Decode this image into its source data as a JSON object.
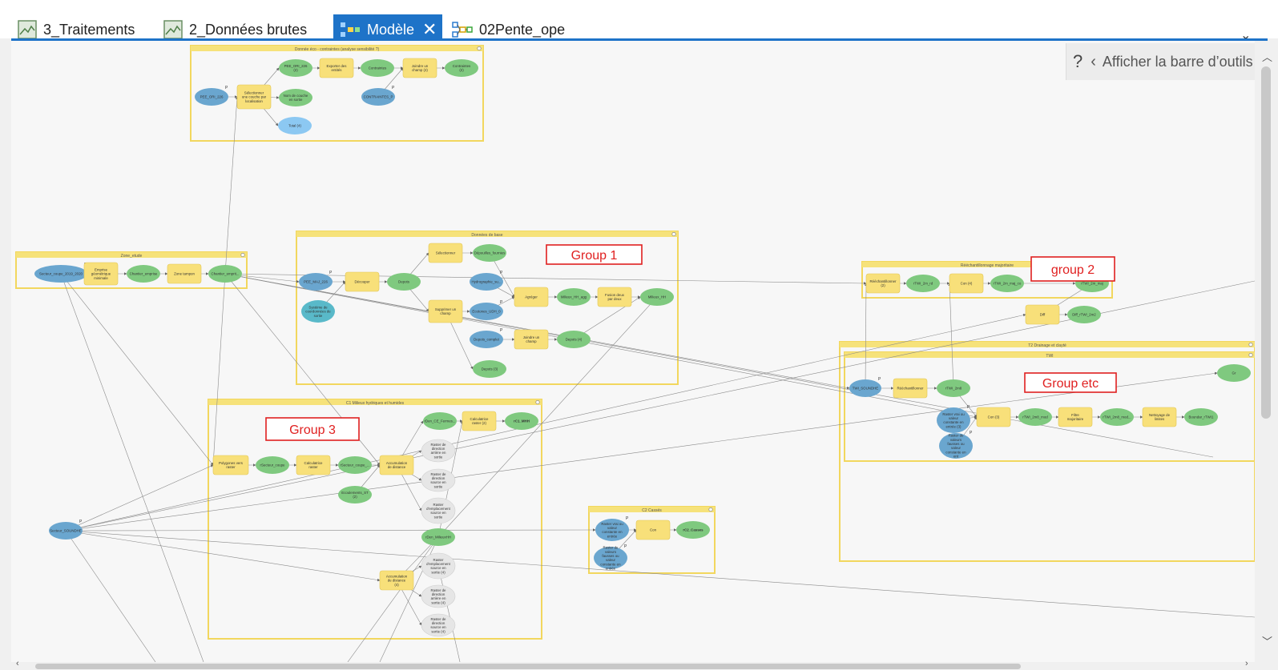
{
  "tabs": [
    {
      "label": "3_Traitements",
      "icon": "map-icon",
      "active": false
    },
    {
      "label": "2_Données brutes",
      "icon": "map-icon",
      "active": false
    },
    {
      "label": "Modèle",
      "icon": "model-icon",
      "active": true
    },
    {
      "label": "02Pente_ope",
      "icon": "model-outline-icon",
      "active": false
    }
  ],
  "toolbar_toggle": {
    "help": "?",
    "label": "Afficher la barre d’outils"
  },
  "annotations": [
    "Group 1",
    "group 2",
    "Group 3",
    "Group etc"
  ],
  "groups": [
    {
      "id": "g_eco",
      "title": "Donnée éco - contraintes (analyse sensibilité ?)"
    },
    {
      "id": "g_zone",
      "title": "Zone_etude"
    },
    {
      "id": "g_base",
      "title": "Données de base"
    },
    {
      "id": "g_reech",
      "title": "Rééchantillonnage majoritaire"
    },
    {
      "id": "g_t2",
      "title": "T2 Drainage et clayté"
    },
    {
      "id": "g_twi",
      "title": "TWI"
    },
    {
      "id": "g_c1",
      "title": "C1 Milieux hydriques et humides"
    },
    {
      "id": "g_c2",
      "title": "C2 Cassés"
    }
  ],
  "nodes": [
    {
      "t": "b",
      "label": "PEE_ORI_226"
    },
    {
      "t": "y",
      "label": "Sélectionner une couche par localisation"
    },
    {
      "t": "g",
      "label": "PEE_ORI_226 (2)"
    },
    {
      "t": "y",
      "label": "Exporter des entités"
    },
    {
      "t": "g",
      "label": "Contraintes"
    },
    {
      "t": "y",
      "label": "Joindre un champ (2)"
    },
    {
      "t": "g",
      "label": "Contraintes (2)"
    },
    {
      "t": "g",
      "label": "Nom de couche en sortie"
    },
    {
      "t": "b",
      "label": "CONTRAINTES_P"
    },
    {
      "t": "lb",
      "label": "Total (4)"
    },
    {
      "t": "b",
      "label": "Secteur_coupe_2019_2020"
    },
    {
      "t": "y",
      "label": "Emprise géométrique minimale"
    },
    {
      "t": "g",
      "label": "Chantier_emprise"
    },
    {
      "t": "y",
      "label": "Zone tampon"
    },
    {
      "t": "g",
      "label": "Chantier_emprit..."
    },
    {
      "t": "b",
      "label": "PEE_MAJ_226"
    },
    {
      "t": "y",
      "label": "Découper"
    },
    {
      "t": "g",
      "label": "Depots"
    },
    {
      "t": "y",
      "label": "Sélectionner"
    },
    {
      "t": "g",
      "label": "Dépouilles_fournies"
    },
    {
      "t": "b",
      "label": "Hydrographie_su..."
    },
    {
      "t": "y",
      "label": "Agréger"
    },
    {
      "t": "g",
      "label": "Milieux_HH_agg"
    },
    {
      "t": "y",
      "label": "Fusion deux par deux"
    },
    {
      "t": "g",
      "label": "Milieux_HH"
    },
    {
      "t": "t",
      "label": "Système de coordonnées de sortie"
    },
    {
      "t": "y",
      "label": "Supprimer un champ"
    },
    {
      "t": "b",
      "label": "Ecotones_UDH_0"
    },
    {
      "t": "b",
      "label": "Depots_complet"
    },
    {
      "t": "y",
      "label": "Joindre un champ"
    },
    {
      "t": "g",
      "label": "Depots (4)"
    },
    {
      "t": "g",
      "label": "Depots (3)"
    },
    {
      "t": "y",
      "label": "Rééchantillonner (2)"
    },
    {
      "t": "g",
      "label": "rTWI_2m_rd"
    },
    {
      "t": "y",
      "label": "Con (4)"
    },
    {
      "t": "g",
      "label": "rTWI_2m_maj_co"
    },
    {
      "t": "g",
      "label": "rTWI_2m_maj"
    },
    {
      "t": "y",
      "label": "Diff"
    },
    {
      "t": "g",
      "label": "Diff_rTWI_2m2"
    },
    {
      "t": "b",
      "label": "TWI_SOUNDHE"
    },
    {
      "t": "y",
      "label": "Rééchantillonner"
    },
    {
      "t": "g",
      "label": "rTWI_2m8"
    },
    {
      "t": "b",
      "label": "Raster vrai ou valeur constante en entrée (3)"
    },
    {
      "t": "b",
      "label": "Raster de valeurs fausses ou valeur constante en ent"
    },
    {
      "t": "y",
      "label": "Con (3)"
    },
    {
      "t": "g",
      "label": "rTWI_2m8_mod"
    },
    {
      "t": "y",
      "label": "Filtre majoritaire"
    },
    {
      "t": "g",
      "label": "rTWI_2m8_mod..."
    },
    {
      "t": "y",
      "label": "Nettoyage de limites"
    },
    {
      "t": "g",
      "label": "Boundar_rTWI1"
    },
    {
      "t": "y",
      "label": "Polygones vers raster"
    },
    {
      "t": "g",
      "label": "rSecteur_coupe"
    },
    {
      "t": "y",
      "label": "Calculatrice raster"
    },
    {
      "t": "g",
      "label": "rSecteur_coupe_..."
    },
    {
      "t": "y",
      "label": "Accumulation de distance"
    },
    {
      "t": "g",
      "label": "rDen_CE_Fermes..."
    },
    {
      "t": "y",
      "label": "Calculatrice raster (2)"
    },
    {
      "t": "g",
      "label": "rC1_MHH"
    },
    {
      "t": "gr",
      "label": "Raster de direction arrière en sortie"
    },
    {
      "t": "gr",
      "label": "Raster de direction source en sortie"
    },
    {
      "t": "gr",
      "label": "Raster d'emplacement source en sortie"
    },
    {
      "t": "g",
      "label": "Ecoulements_ST (2)"
    },
    {
      "t": "g",
      "label": "rDen_MilieuxHH"
    },
    {
      "t": "y",
      "label": "Accumulation de distance (4)"
    },
    {
      "t": "gr",
      "label": "Raster d'emplacement source en sortie (4)"
    },
    {
      "t": "gr",
      "label": "Raster de direction arrière en sortie (4)"
    },
    {
      "t": "gr",
      "label": "Raster de direction source en sortie (4)"
    },
    {
      "t": "b",
      "label": "Secteur_SOUNDHE"
    },
    {
      "t": "b",
      "label": "Raster vrai ou valeur constante en entrée"
    },
    {
      "t": "y",
      "label": "Con"
    },
    {
      "t": "g",
      "label": "rC2_Casses"
    },
    {
      "t": "b",
      "label": "Raster de valeurs fausses ou valeur constante en entrée"
    },
    {
      "t": "g",
      "label": "Gr"
    }
  ],
  "colors": {
    "accent": "#1e73c8",
    "group_border": "#f2d75e",
    "group_header": "#f6e27a",
    "data_blue": "#6aa6cf",
    "tool_yellow": "#f8e07a",
    "derived_green": "#7fc97f",
    "annotation_red": "#e02020"
  }
}
